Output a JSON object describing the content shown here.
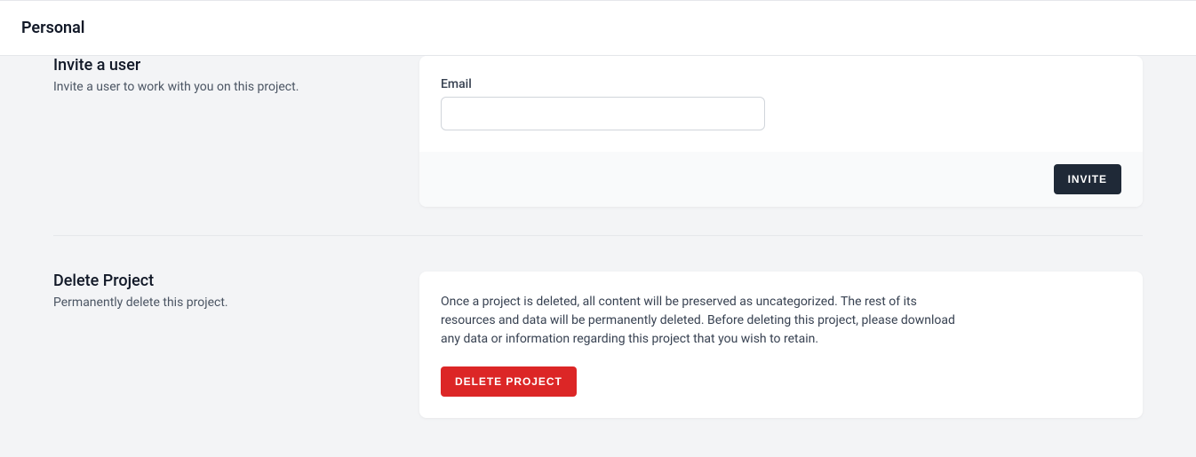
{
  "header": {
    "title": "Personal"
  },
  "invite": {
    "title": "Invite a user",
    "description": "Invite a user to work with you on this project.",
    "form": {
      "email_label": "Email",
      "email_value": ""
    },
    "button_label": "Invite"
  },
  "delete": {
    "title": "Delete Project",
    "description": "Permanently delete this project.",
    "warning_text": "Once a project is deleted, all content will be preserved as uncategorized. The rest of its resources and data will be permanently deleted. Before deleting this project, please download any data or information regarding this project that you wish to retain.",
    "button_label": "Delete Project"
  }
}
